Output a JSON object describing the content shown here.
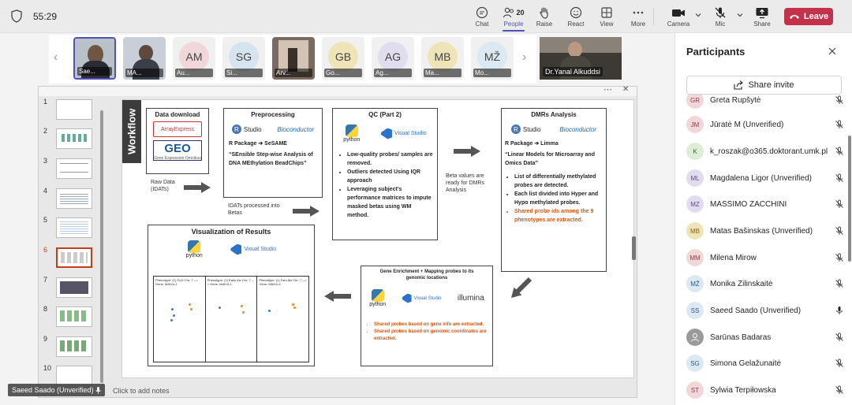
{
  "meeting": {
    "timer": "55:29"
  },
  "toolbar": {
    "chat": "Chat",
    "people": "People",
    "people_count": "20",
    "raise": "Raise",
    "react": "React",
    "view": "View",
    "more": "More",
    "camera": "Camera",
    "mic": "Mic",
    "share": "Share",
    "leave": "Leave"
  },
  "strip": {
    "tiles": [
      {
        "initials": "",
        "name": "Sae...",
        "color": "#8a7a6a"
      },
      {
        "initials": "",
        "name": "MA...",
        "color": "#7a8aa0"
      },
      {
        "initials": "AM",
        "name": "Au...",
        "color": "#f1d7da"
      },
      {
        "initials": "SG",
        "name": "Si...",
        "color": "#d6e4f0"
      },
      {
        "initials": "",
        "name": "Arv...",
        "color": "#6b5d55"
      },
      {
        "initials": "GB",
        "name": "Go...",
        "color": "#efe3b8"
      },
      {
        "initials": "AG",
        "name": "Ag...",
        "color": "#e2dcef"
      },
      {
        "initials": "MB",
        "name": "Ma...",
        "color": "#efe3b8"
      },
      {
        "initials": "MŽ",
        "name": "Mo...",
        "color": "#dce8f2"
      }
    ],
    "large_name": "Dr.Yanal Alkuddsi"
  },
  "slides": {
    "numbers": [
      "1",
      "2",
      "3",
      "4",
      "5",
      "6",
      "7",
      "8",
      "9",
      "10"
    ],
    "selected": "6",
    "notes": "Click to add notes"
  },
  "slide": {
    "workflow": "Workflow",
    "data_download": "Data download",
    "arrayexpress": "ArrayExpress",
    "geo": "GEO",
    "geo_sub": "Gene Expression Omnibus",
    "raw_data": "Raw Data (IDATs)",
    "preproc_title": "Preprocessing",
    "rstudio": "Studio",
    "bioconductor": "Bioconductor",
    "rpackage_sesame": "R Package ➔ SeSAME",
    "sesame_desc": "“SEnsible Step-wise Analysis of DNA MEthylation BeadChips”",
    "idats_processed": "IDATs processed into Betas",
    "qc_title": "QC (Part 2)",
    "python": "python",
    "visual_studio": "Visual Studio",
    "qc_items": [
      "Low-quality probes/ samples are removed.",
      "Outliers detected Using IQR approach",
      "Leveraging subject’s performance matrices to impute masked betas using WM method."
    ],
    "beta_ready": "Beta values are ready for DMRs Analysis",
    "dmr_title": "DMRs Analysis",
    "rpackage_limma": "R Package ➔ Limma",
    "limma_desc": "“Linear Models for Microarray and Omics Data”",
    "dmr_items": [
      "List of differentially methylated probes are detected.",
      "Each list divided into Hyper and Hypo methylated probes."
    ],
    "dmr_highlight": "Shared probe ids among the 9 phenotypes are extracted.",
    "vis_title": "Visualization of Results",
    "plot_titles": [
      "Phenotype: (1) OLD Chr: 7 --> Gene: MAD1L1",
      "Phenotype: (1) Early Alz Chr: 7 --> Gene: MAD1L1",
      "Phenotype: (1) Fam Alz Chr: 7 --> Gene: MAD1L1"
    ],
    "enrich_title": "Gene Enrichment + Mapping probes to its genomic locations",
    "illumina": "illumina",
    "enrich_items": [
      "Shared probes based on gene info are extracted.",
      "Shared probes based on genomic coordinates are extracted."
    ]
  },
  "caption": "Saeed Saado (Unverified)",
  "participants": {
    "title": "Participants",
    "invite": "Share invite",
    "list": [
      {
        "initials": "GR",
        "name": "Greta Rupšytė",
        "color": "#f1d7da",
        "mic": "muted"
      },
      {
        "initials": "JM",
        "name": "Jūratė M (Unverified)",
        "color": "#f1d7da",
        "mic": "muted"
      },
      {
        "initials": "K",
        "name": "k_roszak@o365.doktorant.umk.pl",
        "color": "#dcefd6",
        "mic": "muted"
      },
      {
        "initials": "ML",
        "name": "Magdalena Ligor (Unverified)",
        "color": "#e2dcef",
        "mic": "muted"
      },
      {
        "initials": "MZ",
        "name": "MASSIMO ZACCHINI",
        "color": "#e2dcef",
        "mic": "muted"
      },
      {
        "initials": "MB",
        "name": "Matas Bašinskas (Unverified)",
        "color": "#efe3b8",
        "mic": "muted"
      },
      {
        "initials": "MM",
        "name": "Milena Mirow",
        "color": "#f1d7da",
        "mic": "muted"
      },
      {
        "initials": "MŽ",
        "name": "Monika Žilinskaitė",
        "color": "#dce8f2",
        "mic": "muted"
      },
      {
        "initials": "SS",
        "name": "Saeed Saado (Unverified)",
        "color": "#dce8f2",
        "mic": "on"
      },
      {
        "initials": "",
        "name": "Šarūnas Badaras",
        "color": "#9a9a9a",
        "mic": "muted"
      },
      {
        "initials": "SG",
        "name": "Simona Gelažunaitė",
        "color": "#dce8f2",
        "mic": "muted"
      },
      {
        "initials": "ST",
        "name": "Sylwia Terpiłowska",
        "color": "#f1d7da",
        "mic": "muted"
      }
    ]
  }
}
